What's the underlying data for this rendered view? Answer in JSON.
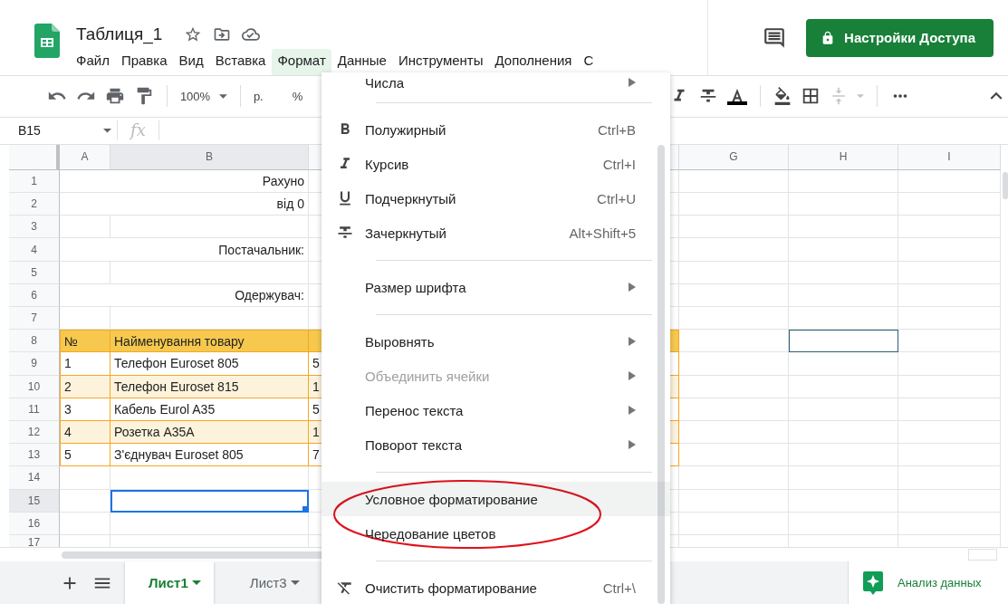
{
  "document": {
    "title": "Таблиця_1"
  },
  "menu_bar": [
    {
      "label": "Файл",
      "selected": false
    },
    {
      "label": "Правка",
      "selected": false
    },
    {
      "label": "Вид",
      "selected": false
    },
    {
      "label": "Вставка",
      "selected": false
    },
    {
      "label": "Формат",
      "selected": true
    },
    {
      "label": "Данные",
      "selected": false
    },
    {
      "label": "Инструменты",
      "selected": false
    },
    {
      "label": "Дополнения",
      "selected": false
    },
    {
      "label": "С",
      "selected": false
    }
  ],
  "share_button": {
    "label": "Настройки Доступа"
  },
  "toolbar": {
    "zoom": "100%",
    "currency": "р.",
    "percent": "%"
  },
  "formula_bar": {
    "cell_reference": "B15",
    "function_label": "fx"
  },
  "columns": [
    "A",
    "B",
    "G",
    "H",
    "I"
  ],
  "rows": [
    {
      "number": "1",
      "kind": "title",
      "text": "Рахуно",
      "shaded": false
    },
    {
      "number": "2",
      "kind": "title",
      "text": "від 0",
      "shaded": false
    },
    {
      "number": "3",
      "kind": "blank",
      "shaded": false
    },
    {
      "number": "4",
      "kind": "title",
      "text": "Постачальник:",
      "shaded": false
    },
    {
      "number": "5",
      "kind": "blank",
      "shaded": false
    },
    {
      "number": "6",
      "kind": "title",
      "text": "Одержувач:",
      "shaded": false
    },
    {
      "number": "7",
      "kind": "blank",
      "shaded": false
    },
    {
      "number": "8",
      "kind": "header",
      "cells": [
        "№",
        "Найменування товару"
      ],
      "collaborator_cursor": true
    },
    {
      "number": "9",
      "kind": "item",
      "cells": [
        "1",
        "Телефон Euroset 805",
        "5"
      ],
      "shaded": false
    },
    {
      "number": "10",
      "kind": "item",
      "cells": [
        "2",
        "Телефон Euroset 815",
        "1"
      ],
      "shaded": true
    },
    {
      "number": "11",
      "kind": "item",
      "cells": [
        "3",
        "Кабель  Eurol A35",
        "5"
      ],
      "shaded": false
    },
    {
      "number": "12",
      "kind": "item",
      "cells": [
        "4",
        "Розетка А35А",
        "1"
      ],
      "shaded": true
    },
    {
      "number": "13",
      "kind": "item",
      "cells": [
        "5",
        "З'єднувач Euroset 805",
        "7"
      ],
      "shaded": false
    },
    {
      "number": "14",
      "kind": "blank",
      "shaded": false
    },
    {
      "number": "15",
      "kind": "blank",
      "shaded": false,
      "cell_selected": true
    },
    {
      "number": "16",
      "kind": "blank",
      "shaded": false
    },
    {
      "number": "17",
      "kind": "blank",
      "shaded": false
    }
  ],
  "format_menu": [
    {
      "kind": "plain",
      "label": "Числа",
      "submenu": true,
      "disabled": false,
      "selected": false
    },
    {
      "kind": "separator"
    },
    {
      "kind": "bold",
      "label": "Полужирный",
      "shortcut": "Ctrl+B",
      "submenu": false,
      "disabled": false,
      "selected": false
    },
    {
      "kind": "italic",
      "label": "Курсив",
      "shortcut": "Ctrl+I",
      "submenu": false,
      "disabled": false,
      "selected": false
    },
    {
      "kind": "underline",
      "label": "Подчеркнутый",
      "shortcut": "Ctrl+U",
      "submenu": false,
      "disabled": false,
      "selected": false
    },
    {
      "kind": "strikethrough",
      "label": "Зачеркнутый",
      "shortcut": "Alt+Shift+5",
      "submenu": false,
      "disabled": false,
      "selected": false
    },
    {
      "kind": "separator"
    },
    {
      "kind": "plain",
      "label": "Размер шрифта",
      "submenu": true,
      "disabled": false,
      "selected": false
    },
    {
      "kind": "separator"
    },
    {
      "kind": "plain",
      "label": "Выровнять",
      "submenu": true,
      "disabled": false,
      "selected": false
    },
    {
      "kind": "plain",
      "label": "Объединить ячейки",
      "submenu": true,
      "disabled": true,
      "selected": false
    },
    {
      "kind": "plain",
      "label": "Перенос текста",
      "submenu": true,
      "disabled": false,
      "selected": false
    },
    {
      "kind": "plain",
      "label": "Поворот текста",
      "submenu": true,
      "disabled": false,
      "selected": false
    },
    {
      "kind": "separator"
    },
    {
      "kind": "plain",
      "label": "Условное форматирование",
      "submenu": false,
      "disabled": false,
      "selected": true
    },
    {
      "kind": "plain",
      "label": "Чередование цветов",
      "submenu": false,
      "disabled": false,
      "selected": false
    },
    {
      "kind": "separator"
    },
    {
      "kind": "clear",
      "label": "Очистить форматирование",
      "shortcut": "Ctrl+\\",
      "submenu": false,
      "disabled": false,
      "selected": false
    }
  ],
  "sheet_tabs": [
    {
      "label": "Лист1",
      "selected": true
    },
    {
      "label": "Лист3",
      "selected": false
    }
  ],
  "explore_button": {
    "label": "Анализ данных"
  }
}
